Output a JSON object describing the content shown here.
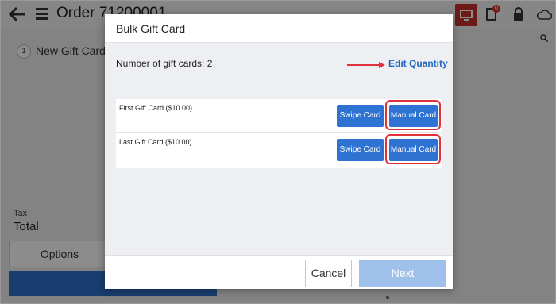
{
  "app": {
    "order_title": "Order 71200001",
    "notification_count": "0"
  },
  "background": {
    "item_number": "1",
    "item_label": "New Gift Card",
    "tax_label": "Tax",
    "total_label": "Total",
    "options_label": "Options"
  },
  "modal": {
    "title": "Bulk Gift Card",
    "count_label": "Number of gift cards: 2",
    "edit_quantity_label": "Edit Quantity",
    "cards": [
      {
        "label": "First Gift Card ($10.00)",
        "swipe_label": "Swipe Card",
        "manual_label": "Manual Card"
      },
      {
        "label": "Last Gift Card ($10.00)",
        "swipe_label": "Swipe Card",
        "manual_label": "Manual Card"
      }
    ],
    "cancel_label": "Cancel",
    "next_label": "Next"
  },
  "colors": {
    "accent": "#2e72d2",
    "highlight": "#e0303c",
    "next_disabled": "#9ec0ea",
    "alert": "#c8302a"
  },
  "icons": [
    "back-arrow-icon",
    "menu-icon",
    "monitor-icon",
    "receipt-icon",
    "lock-icon",
    "cloud-icon",
    "search-icon",
    "arrow-right-icon"
  ]
}
